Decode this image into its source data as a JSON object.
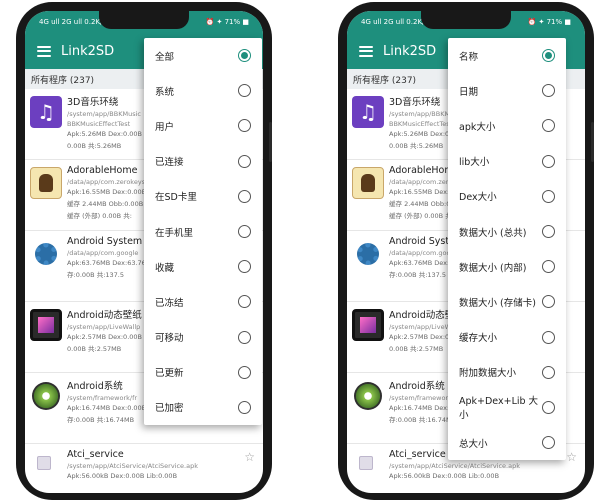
{
  "status_bar": {
    "left": "4G ull 2G ull 0.2K/s ▲ ●",
    "right": "⏰ ✦ 71% ■"
  },
  "app_bar": {
    "title": "Link2SD"
  },
  "list_header": "所有程序 (237)",
  "apps": [
    {
      "name": "3D音乐环绕",
      "icon": "music-icon",
      "lines": [
        "/system/app/BBKMusic",
        "BBKMusicEffectTest",
        "Apk:5.26MB   Dex:0.00B",
        "0.00B   共:5.26MB"
      ],
      "star": false
    },
    {
      "name": "AdorableHome",
      "icon": "adorable-avatar-icon",
      "lines": [
        "/data/app/com.zerokeys",
        "Apk:16.55MB  Dex:0.00B",
        "缓存 2.44MB  Obb:0.00B",
        "缓存 (外部) 0.00B  共:"
      ],
      "star": false
    },
    {
      "name": "Android System",
      "icon": "gear-icon",
      "lines": [
        "/data/app/com.google",
        "Apk:63.76MB  Dex:63.76MB",
        "存:0.00B   共:137.5"
      ],
      "star": false
    },
    {
      "name": "Android动态壁纸",
      "icon": "live-wallpaper-icon",
      "lines": [
        "/system/app/LiveWallp",
        "Apk:2.57MB  Dex:0.00B",
        "0.00B   共:2.57MB"
      ],
      "star": false
    },
    {
      "name": "Android系统",
      "icon": "disc-icon",
      "lines": [
        "/system/framework/fr",
        "Apk:16.74MB  Dex:0.00B",
        "存:0.00B   共:16.74MB"
      ],
      "star": false
    },
    {
      "name": "Atci_service",
      "icon": "service-icon",
      "lines": [
        "/system/app/AtciService/AtciService.apk",
        "Apk:56.00kB  Dex:0.00B  Lib:0.00B"
      ],
      "star": true
    }
  ],
  "filter_menu": {
    "selected_index": 0,
    "items": [
      "全部",
      "系统",
      "用户",
      "已连接",
      "在SD卡里",
      "在手机里",
      "收藏",
      "已冻结",
      "可移动",
      "已更新",
      "已加密"
    ]
  },
  "sort_menu": {
    "selected_index": 0,
    "items": [
      "名称",
      "日期",
      "apk大小",
      "lib大小",
      "Dex大小",
      "数据大小 (总共)",
      "数据大小 (内部)",
      "数据大小 (存储卡)",
      "缓存大小",
      "附加数据大小",
      "Apk+Dex+Lib 大小",
      "总大小"
    ]
  },
  "colors": {
    "accent": "#1e8f7d",
    "app_bar": "#1e8f7d",
    "menu_bg": "#ffffff"
  }
}
